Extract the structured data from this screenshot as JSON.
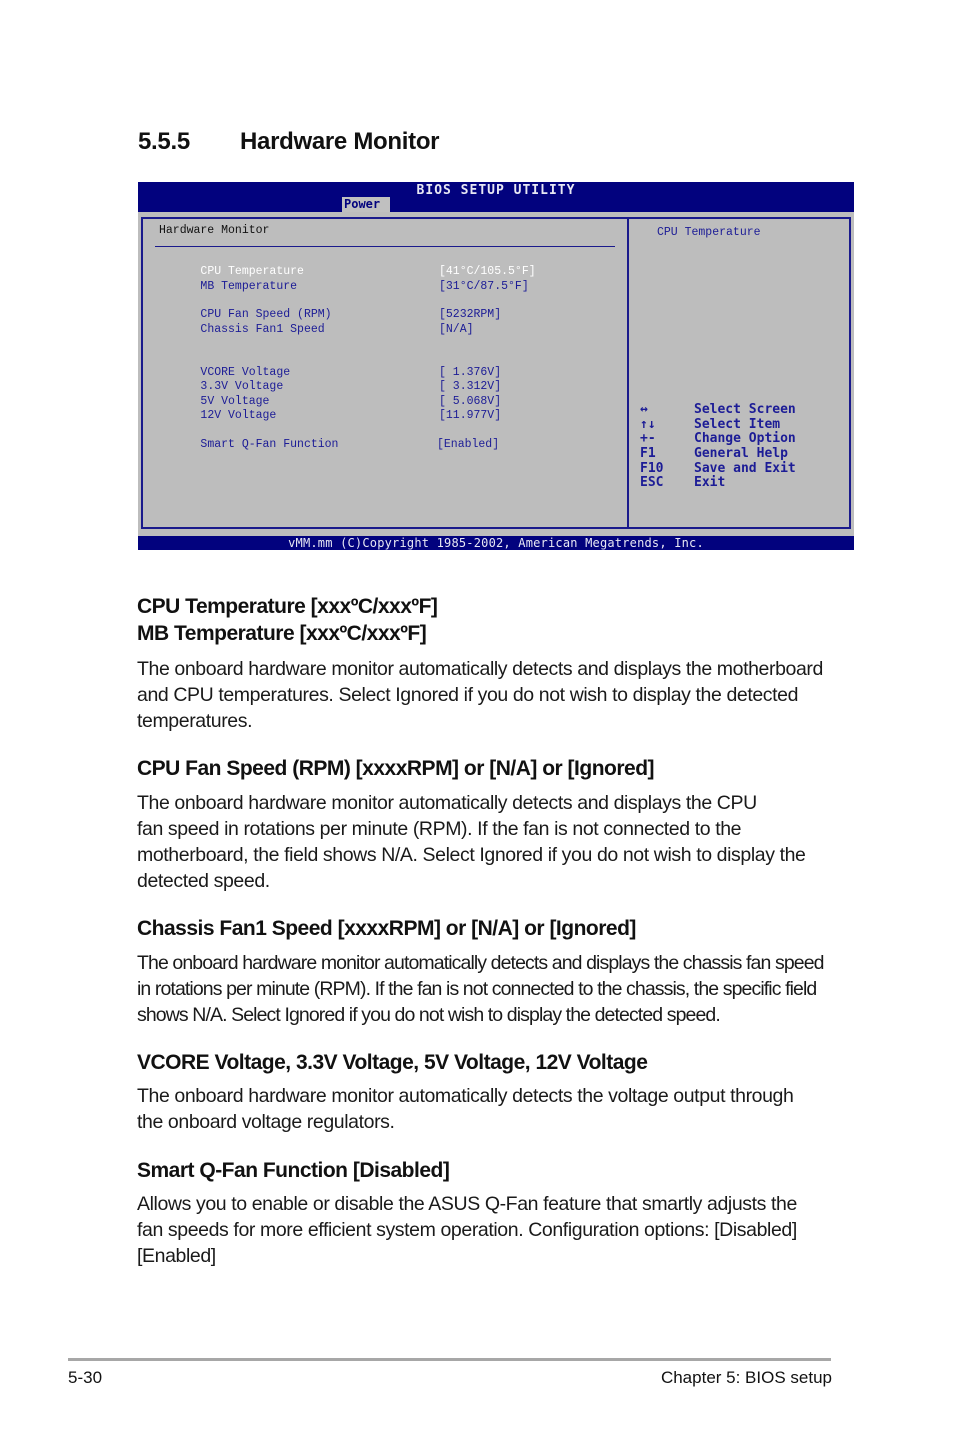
{
  "section": {
    "number": "5.5.5",
    "title": "Hardware Monitor"
  },
  "bios": {
    "title": "BIOS SETUP UTILITY",
    "active_tab": "Power",
    "panel_title": "Hardware Monitor",
    "items": [
      {
        "label": "CPU Temperature",
        "value": "[41°C/105.5°F]",
        "selected": true
      },
      {
        "label": "MB Temperature",
        "value": "[31°C/87.5°F]",
        "selected": false
      },
      {
        "label": "CPU Fan Speed (RPM)",
        "value": "[5232RPM]",
        "selected": false
      },
      {
        "label": "Chassis Fan1 Speed",
        "value": "[N/A]",
        "selected": false
      },
      {
        "label": "VCORE Voltage",
        "value": "[ 1.376V]",
        "selected": false
      },
      {
        "label": "3.3V Voltage",
        "value": "[ 3.312V]",
        "selected": false
      },
      {
        "label": "5V Voltage",
        "value": "[ 5.068V]",
        "selected": false
      },
      {
        "label": "12V Voltage",
        "value": "[11.977V]",
        "selected": false
      },
      {
        "label": "Smart Q-Fan Function",
        "value": "[Enabled]",
        "selected": false
      }
    ],
    "help_title": "CPU Temperature",
    "keys": [
      {
        "key": "↔",
        "action": "Select Screen"
      },
      {
        "key": "↑↓",
        "action": "Select Item"
      },
      {
        "key": "+-",
        "action": "Change Option"
      },
      {
        "key": "F1",
        "action": "General Help"
      },
      {
        "key": "F10",
        "action": "Save and Exit"
      },
      {
        "key": "ESC",
        "action": "Exit"
      }
    ],
    "footer": "vMM.mm (C)Copyright 1985-2002, American Megatrends, Inc.",
    "colors": {
      "header_bg": "#02027e",
      "body_bg": "#bdbdbd",
      "text_blue": "#1c1c96",
      "selected_text": "#ffffff"
    }
  },
  "descriptions": [
    {
      "heading_lines": [
        "CPU Temperature [xxxºC/xxxºF]",
        "MB Temperature [xxxºC/xxxºF]"
      ],
      "lines": [
        "The onboard hardware monitor automatically detects and displays the motherboard",
        "and CPU temperatures. Select Ignored if you do not wish to display the detected",
        "temperatures."
      ]
    },
    {
      "heading_lines": [
        "CPU Fan Speed (RPM) [xxxxRPM] or [N/A] or [Ignored]"
      ],
      "lines": [
        "The onboard hardware monitor automatically detects and displays the CPU",
        "fan speed in rotations per minute (RPM). If the fan is not connected to the",
        "motherboard, the field shows N/A. Select Ignored if you do not wish to display the",
        "detected speed."
      ]
    },
    {
      "heading_lines": [
        "Chassis Fan1 Speed [xxxxRPM] or [N/A] or [Ignored]"
      ],
      "lines": [
        "The onboard hardware monitor automatically detects and displays the chassis fan speed",
        "in rotations per minute (RPM). If the fan is not connected to the chassis, the specific field",
        "shows N/A. Select Ignored if you do not wish to display the detected speed."
      ]
    },
    {
      "heading_lines": [
        "VCORE Voltage, 3.3V Voltage, 5V Voltage, 12V Voltage"
      ],
      "lines": [
        "The onboard hardware monitor automatically detects the voltage output through",
        "the onboard voltage regulators."
      ]
    },
    {
      "heading_lines": [
        "Smart Q-Fan Function [Disabled]"
      ],
      "lines": [
        "Allows you to enable or disable the ASUS Q-Fan feature that smartly adjusts the",
        "fan speeds for more efficient system operation. Configuration options: [Disabled]",
        "[Enabled]"
      ]
    }
  ],
  "page_footer": {
    "page_number": "5-30",
    "chapter": "Chapter 5: BIOS setup"
  }
}
